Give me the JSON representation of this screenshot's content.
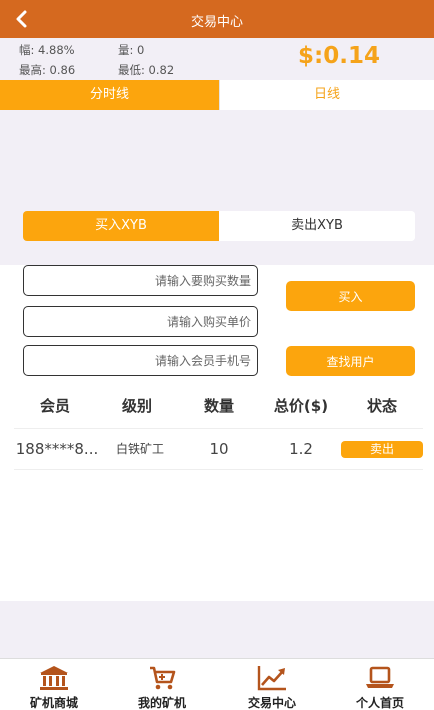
{
  "header": {
    "title": "交易中心",
    "back_icon": "chevron-left-icon"
  },
  "stats": {
    "change_label": "幅: 4.88%",
    "volume_label": "量: 0",
    "high_label": "最高: 0.86",
    "low_label": "最低: 0.82",
    "price": "$:0.14"
  },
  "chart_tabs": [
    {
      "label": "分时线"
    },
    {
      "label": "日线"
    }
  ],
  "trade_tabs": [
    {
      "label": "买入XYB"
    },
    {
      "label": "卖出XYB"
    }
  ],
  "form": {
    "quantity_placeholder": "请输入要购买数量",
    "unit_price_placeholder": "请输入购买单价",
    "phone_placeholder": "请输入会员手机号",
    "buy_label": "买入",
    "find_user_label": "查找用户"
  },
  "table": {
    "headers": [
      "会员",
      "级别",
      "数量",
      "总价($)",
      "状态"
    ],
    "rows": [
      {
        "member": "188****8...",
        "level": "白铁矿工",
        "quantity": "10",
        "total": "1.2",
        "action": "卖出"
      }
    ]
  },
  "nav": [
    {
      "label": "矿机商城",
      "icon": "bank-icon"
    },
    {
      "label": "我的矿机",
      "icon": "cart-icon"
    },
    {
      "label": "交易中心",
      "icon": "trend-chart-icon"
    },
    {
      "label": "个人首页",
      "icon": "laptop-icon"
    }
  ],
  "colors": {
    "header": "#d5691f",
    "accent": "#fca50d",
    "price": "#f5a31a",
    "nav_icon": "#b4541c"
  }
}
